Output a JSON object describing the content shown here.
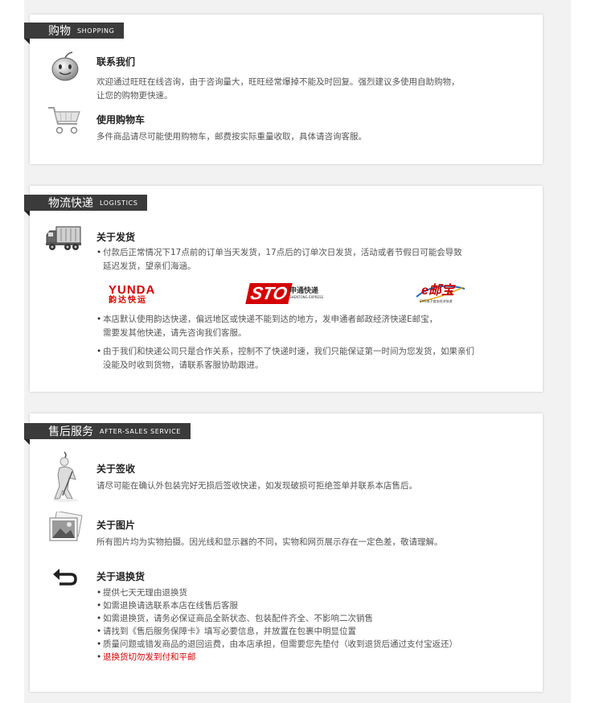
{
  "shopping": {
    "tab_cn": "购物",
    "tab_en": "SHOPPING",
    "items": [
      {
        "title": "联系我们",
        "lines": [
          "欢迎通过旺旺在线咨询，由于咨询量大，旺旺经常爆掉不能及时回复。强烈建议多使用自助购物，",
          "让您的购物更快速。"
        ]
      },
      {
        "title": "使用购物车",
        "lines": [
          "多件商品请尽可能使用购物车，邮费按实际重量收取，具体请咨询客服。"
        ]
      }
    ]
  },
  "logistics": {
    "tab_cn": "物流快递",
    "tab_en": "LOGISTICS",
    "title": "关于发货",
    "bullets_top": [
      {
        "lines": [
          "付款后正常情况下17点前的订单当天发货，17点后的订单次日发货，活动或者节假日可能会导致",
          "延迟发货，望亲们海涵。"
        ]
      }
    ],
    "logos": [
      {
        "name": "yunda",
        "text_main": "YUNDA",
        "text_sub": "韵达快运",
        "color": "#d40000"
      },
      {
        "name": "sto",
        "text_main": "STO",
        "text_sub": "申通快递",
        "text_small": "SHENTONG EXPRESS",
        "color": "#d40000"
      },
      {
        "name": "ems",
        "text_main": "e邮宝",
        "text_small": "EMS电子商务经济快递",
        "color": "#c00000"
      }
    ],
    "bullets_bottom": [
      {
        "lines": [
          "本店默认使用韵达快递，偏远地区或快递不能到达的地方，发申通者邮政经济快递E邮宝，",
          "需要发其他快递，请先咨询我们客服。"
        ]
      },
      {
        "lines": [
          "由于我们和快递公司只是合作关系，控制不了快递时速，我们只能保证第一时间为您发货，如果亲们",
          "没能及时收到货物，请联系客服协助跟进。"
        ]
      }
    ]
  },
  "after_sales": {
    "tab_cn": "售后服务",
    "tab_en": "AFTER-SALES SERVICE",
    "items": [
      {
        "title": "关于签收",
        "lines": [
          "请尽可能在确认外包装完好无损后签收快递，如发现破损可拒绝签单并联系本店售后。"
        ]
      },
      {
        "title": "关于图片",
        "lines": [
          "所有图片均为实物拍摄。因光线和显示器的不同，实物和网页展示存在一定色差，敬请理解。"
        ]
      },
      {
        "title": "关于退换货",
        "bullets": [
          "提供七天无理由退换货",
          "如需退换请选联系本店在线售后客服",
          "如需退换货，请务必保证商品全新状态、包装配件齐全、不影响二次销售",
          "请找到《售后服务保障卡》填写必要信息，并放置在包裹中明显位置",
          "质量问题或错发商品的退回运费，由本店承担，但需要您先垫付（收到退货后通过支付宝返还）",
          "退换货切勿发到付和平邮"
        ],
        "highlight_color": "#d40000"
      }
    ]
  },
  "icons": {
    "contact": "chat-face-icon",
    "cart": "shopping-cart-icon",
    "truck": "delivery-truck-icon",
    "sign": "sign-figure-icon",
    "photo": "photo-icon",
    "return": "return-arrows-icon"
  }
}
